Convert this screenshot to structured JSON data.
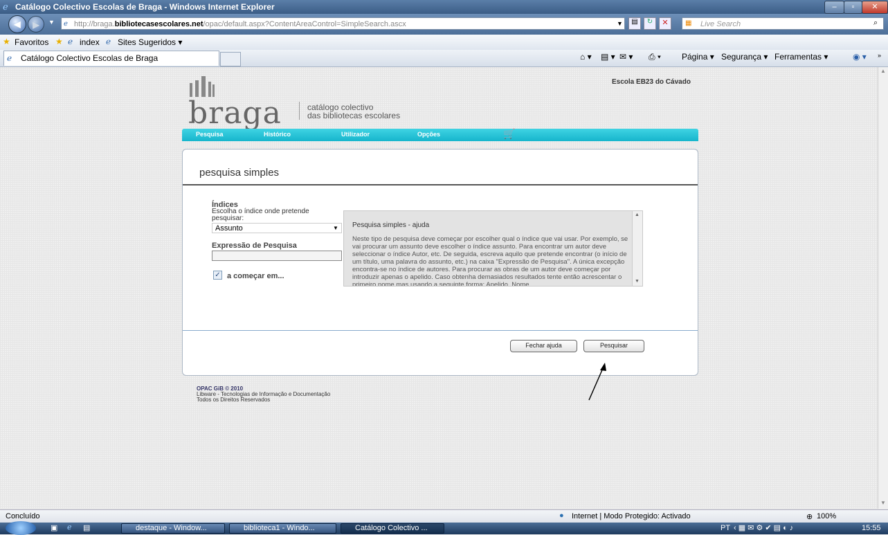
{
  "window": {
    "title": "Catálogo Colectivo Escolas de Braga - Windows Internet Explorer"
  },
  "address": {
    "prefix": "http://braga.",
    "domain": "bibliotecasescolares.net",
    "path": "/opac/default.aspx?ContentAreaControl=SimpleSearch.ascx",
    "search_placeholder": "Live Search"
  },
  "favbar": {
    "favorites": "Favoritos",
    "index": "index",
    "suggested": "Sites Sugeridos ▾"
  },
  "tab": {
    "label": "Catálogo Colectivo Escolas de Braga"
  },
  "commandbar": {
    "page": "Página ▾",
    "security": "Segurança ▾",
    "tools": "Ferramentas ▾"
  },
  "page": {
    "logo": "braga",
    "catalog_line1": "catálogo colectivo",
    "catalog_line2": "das bibliotecas escolares",
    "school": "Escola EB23 do Cávado",
    "menu": [
      "Pesquisa",
      "Histórico",
      "Utilizador",
      "Opções"
    ],
    "title": "pesquisa simples",
    "index_heading": "Índices",
    "index_desc1": "Escolha o índice onde pretende",
    "index_desc2": "pesquisar:",
    "index_selected": "Assunto",
    "expr_label": "Expressão de Pesquisa",
    "expr_value": "",
    "starts_with": "a começar em...",
    "help_title": "Pesquisa simples - ajuda",
    "help_text": "Neste tipo de pesquisa deve começar por escolher qual o índice que vai usar. Por exemplo, se vai procurar um assunto deve escolher o índice assunto. Para encontrar um autor deve seleccionar o índice Autor, etc. De seguida, escreva aquilo que pretende encontrar (o início de um título, uma palavra do assunto, etc.) na caixa \"Expressão de Pesquisa\". A única excepção encontra-se no índice de autores. Para procurar as obras de um autor deve começar por introduzir apenas o apelido. Caso obtenha demasiados resultados tente então acrescentar o primeiro nome mas usando a seguinte forma: Apelido, Nome",
    "close_help": "Fechar ajuda",
    "search_button": "Pesquisar",
    "footer1": "OPAC GiB © 2010",
    "footer2": "Libware - Tecnologias de Informação e Documentação",
    "footer3": "Todos os Direitos Reservados"
  },
  "status": {
    "left": "Concluído",
    "zone": "Internet | Modo Protegido: Activado",
    "zoom": "100%"
  },
  "taskbar": {
    "tasks": [
      "destaque - Window...",
      "biblioteca1 - Windo...",
      "Catálogo Colectivo ..."
    ],
    "lang": "PT",
    "time": "15:55"
  }
}
